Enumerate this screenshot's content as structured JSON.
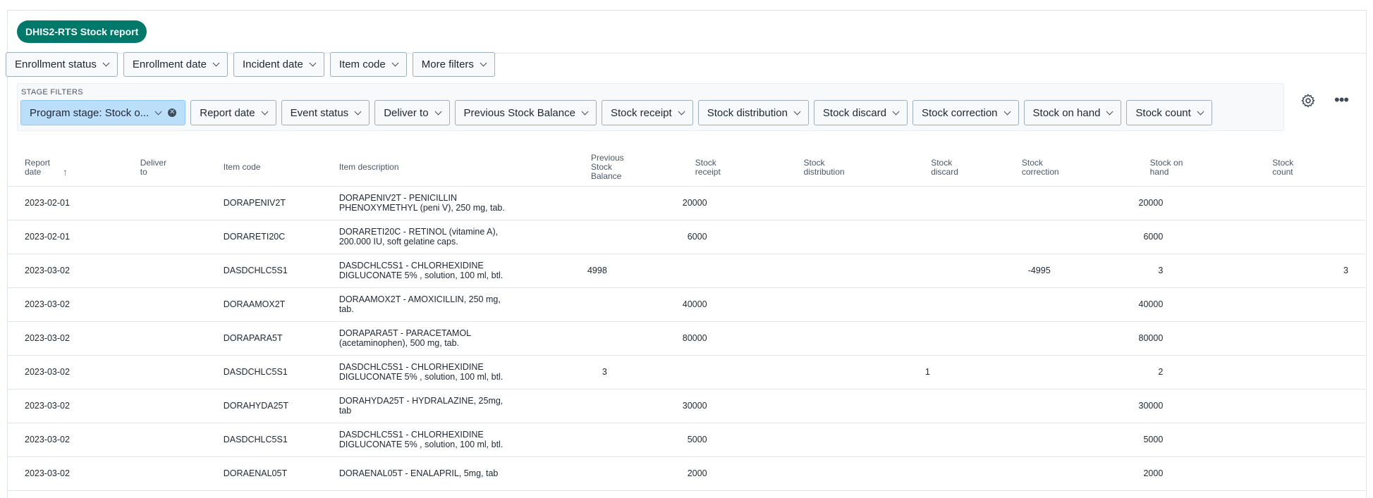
{
  "title_chip": "DHIS2-RTS Stock report",
  "filters": [
    "Enrollment status",
    "Enrollment date",
    "Incident date",
    "Item code",
    "More filters"
  ],
  "stage": {
    "label": "STAGE FILTERS",
    "active_filter": "Program stage: Stock o...",
    "filters": [
      "Report date",
      "Event status",
      "Deliver to",
      "Previous Stock Balance",
      "Stock receipt",
      "Stock distribution",
      "Stock discard",
      "Stock correction",
      "Stock on hand",
      "Stock count"
    ]
  },
  "icons": {
    "settings": "gear-icon",
    "more": "more-horizontal-icon",
    "sort": "arrow-up-icon",
    "clear": "close-circle-icon",
    "chevron": "chevron-down-icon"
  },
  "colors": {
    "accent": "#00796b",
    "active_filter_bg": "#bbdefb"
  },
  "table": {
    "headers": [
      [
        "Report",
        "date"
      ],
      [
        "Deliver",
        "to"
      ],
      [
        "Item code",
        ""
      ],
      [
        "Item description",
        ""
      ],
      [
        "Previous Stock",
        "Balance"
      ],
      [
        "Stock",
        "receipt"
      ],
      [
        "Stock",
        "distribution"
      ],
      [
        "Stock",
        "discard"
      ],
      [
        "Stock",
        "correction"
      ],
      [
        "Stock on",
        "hand"
      ],
      [
        "Stock",
        "count"
      ]
    ],
    "rows": [
      {
        "date": "2023-02-01",
        "deliver": "",
        "code": "DORAPENIV2T",
        "desc1": "DORAPENIV2T - PENICILLIN",
        "desc2": "PHENOXYMETHYL (peni V), 250 mg, tab.",
        "prev": "",
        "receipt": "20000",
        "distribution": "",
        "discard": "",
        "correction": "",
        "onhand": "20000",
        "count": ""
      },
      {
        "date": "2023-02-01",
        "deliver": "",
        "code": "DORARETI20C",
        "desc1": "DORARETI20C - RETINOL (vitamine A),",
        "desc2": "200.000 IU, soft gelatine caps.",
        "prev": "",
        "receipt": "6000",
        "distribution": "",
        "discard": "",
        "correction": "",
        "onhand": "6000",
        "count": ""
      },
      {
        "date": "2023-03-02",
        "deliver": "",
        "code": "DASDCHLC5S1",
        "desc1": "DASDCHLC5S1 - CHLORHEXIDINE",
        "desc2": "DIGLUCONATE 5% , solution, 100 ml, btl.",
        "prev": "4998",
        "receipt": "",
        "distribution": "",
        "discard": "",
        "correction": "-4995",
        "onhand": "3",
        "count": "3"
      },
      {
        "date": "2023-03-02",
        "deliver": "",
        "code": "DORAAMOX2T",
        "desc1": "DORAAMOX2T - AMOXICILLIN, 250 mg,",
        "desc2": "tab.",
        "prev": "",
        "receipt": "40000",
        "distribution": "",
        "discard": "",
        "correction": "",
        "onhand": "40000",
        "count": ""
      },
      {
        "date": "2023-03-02",
        "deliver": "",
        "code": "DORAPARA5T",
        "desc1": "DORAPARA5T - PARACETAMOL",
        "desc2": "(acetaminophen), 500 mg, tab.",
        "prev": "",
        "receipt": "80000",
        "distribution": "",
        "discard": "",
        "correction": "",
        "onhand": "80000",
        "count": ""
      },
      {
        "date": "2023-03-02",
        "deliver": "",
        "code": "DASDCHLC5S1",
        "desc1": "DASDCHLC5S1 - CHLORHEXIDINE",
        "desc2": "DIGLUCONATE 5% , solution, 100 ml, btl.",
        "prev": "3",
        "receipt": "",
        "distribution": "",
        "discard": "1",
        "correction": "",
        "onhand": "2",
        "count": ""
      },
      {
        "date": "2023-03-02",
        "deliver": "",
        "code": "DORAHYDA25T",
        "desc1": "DORAHYDA25T - HYDRALAZINE, 25mg,",
        "desc2": "tab",
        "prev": "",
        "receipt": "30000",
        "distribution": "",
        "discard": "",
        "correction": "",
        "onhand": "30000",
        "count": ""
      },
      {
        "date": "2023-03-02",
        "deliver": "",
        "code": "DASDCHLC5S1",
        "desc1": "DASDCHLC5S1 - CHLORHEXIDINE",
        "desc2": "DIGLUCONATE 5% , solution, 100 ml, btl.",
        "prev": "",
        "receipt": "5000",
        "distribution": "",
        "discard": "",
        "correction": "",
        "onhand": "5000",
        "count": ""
      },
      {
        "date": "2023-03-02",
        "deliver": "",
        "code": "DORAENAL05T",
        "desc1": "DORAENAL05T - ENALAPRIL, 5mg, tab",
        "desc2": "",
        "prev": "",
        "receipt": "2000",
        "distribution": "",
        "discard": "",
        "correction": "",
        "onhand": "2000",
        "count": ""
      }
    ]
  }
}
